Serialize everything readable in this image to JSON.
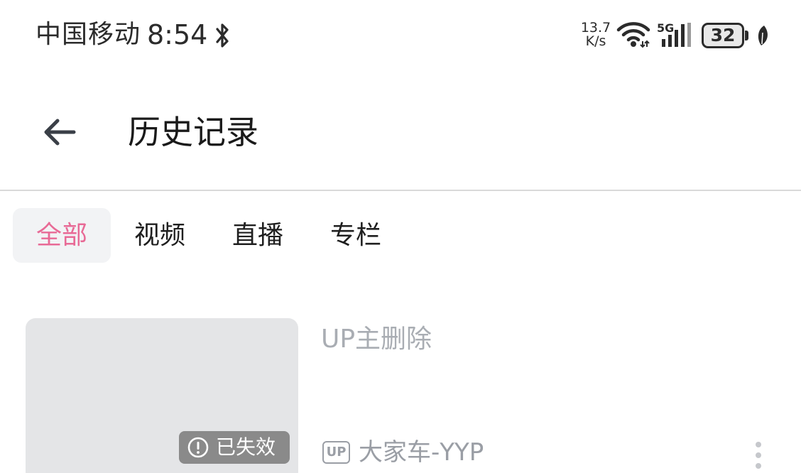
{
  "status_bar": {
    "carrier": "中国移动",
    "time": "8:54",
    "net_speed_value": "13.7",
    "net_speed_unit": "K/s",
    "network_type": "5G",
    "battery_level": "32"
  },
  "header": {
    "title": "历史记录"
  },
  "tabs": [
    {
      "label": "全部",
      "active": true
    },
    {
      "label": "视频",
      "active": false
    },
    {
      "label": "直播",
      "active": false
    },
    {
      "label": "专栏",
      "active": false
    }
  ],
  "history": [
    {
      "title": "UP主删除",
      "status_badge": "已失效",
      "up_badge": "UP",
      "uploader": "大家车-YYP"
    }
  ],
  "colors": {
    "accent": "#e86a96",
    "muted_text": "#a9adb3",
    "thumb_bg": "#e4e5e7",
    "badge_bg": "#8a8a8a"
  }
}
